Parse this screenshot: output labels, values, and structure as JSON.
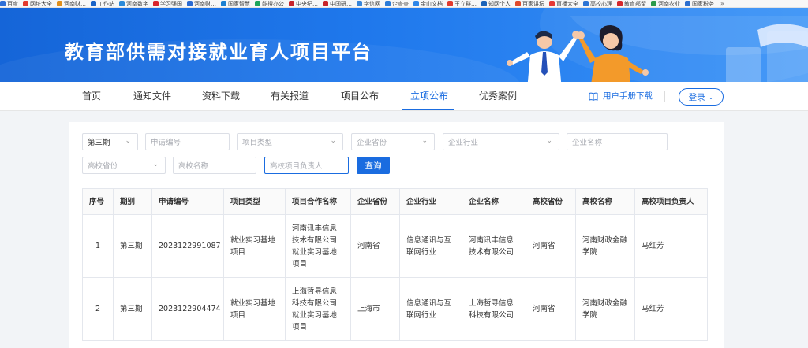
{
  "bookmarks": [
    {
      "label": "百度",
      "color": "#2f6fd6"
    },
    {
      "label": "网址大全",
      "color": "#e13a2f"
    },
    {
      "label": "河南财…",
      "color": "#e08f1c"
    },
    {
      "label": "工作站",
      "color": "#1b64c7"
    },
    {
      "label": "河南数字",
      "color": "#2d8ad8"
    },
    {
      "label": "学习强国",
      "color": "#d9252c"
    },
    {
      "label": "河南财…",
      "color": "#2c6bd2"
    },
    {
      "label": "国家智慧",
      "color": "#1b7fd1"
    },
    {
      "label": "能搜办公",
      "color": "#1ea55c"
    },
    {
      "label": "中央纪…",
      "color": "#c8252b"
    },
    {
      "label": "中国研…",
      "color": "#c8252b"
    },
    {
      "label": "学信网",
      "color": "#3a86d9"
    },
    {
      "label": "企查查",
      "color": "#2b7bd8"
    },
    {
      "label": "金山文档",
      "color": "#2f86e8"
    },
    {
      "label": "王立群…",
      "color": "#e23b2f"
    },
    {
      "label": "知网个人",
      "color": "#1c63b8"
    },
    {
      "label": "百家讲坛",
      "color": "#e04a2a"
    },
    {
      "label": "直播大全",
      "color": "#e53935"
    },
    {
      "label": "高校心理",
      "color": "#2c74d4"
    },
    {
      "label": "教育部留",
      "color": "#d6292d"
    },
    {
      "label": "河南农业",
      "color": "#2c9a4a"
    },
    {
      "label": "国家税务",
      "color": "#2d6fcf"
    }
  ],
  "banner": {
    "title": "教育部供需对接就业育人项目平台"
  },
  "nav": {
    "items": [
      "首页",
      "通知文件",
      "资料下载",
      "有关报道",
      "项目公布",
      "立项公布",
      "优秀案例"
    ],
    "active": "立项公布",
    "manual": "用户手册下载",
    "login": "登录"
  },
  "filters": {
    "period": "第三期",
    "app_no": "申请编号",
    "project_type": "项目类型",
    "ent_province": "企业省份",
    "ent_industry": "企业行业",
    "ent_name": "企业名称",
    "uni_province": "高校省份",
    "uni_name": "高校名称",
    "uni_leader": "高校项目负责人",
    "query": "查询"
  },
  "table": {
    "headers": [
      "序号",
      "期别",
      "申请编号",
      "项目类型",
      "项目合作名称",
      "企业省份",
      "企业行业",
      "企业名称",
      "高校省份",
      "高校名称",
      "高校项目负责人"
    ],
    "rows": [
      [
        "1",
        "第三期",
        "2023122991087",
        "就业实习基地项目",
        "河南讯丰信息技术有限公司就业实习基地项目",
        "河南省",
        "信息通讯与互联网行业",
        "河南讯丰信息技术有限公司",
        "河南省",
        "河南财政金融学院",
        "马红芳"
      ],
      [
        "2",
        "第三期",
        "2023122904474",
        "就业实习基地项目",
        "上海哲寻信息科技有限公司就业实习基地项目",
        "上海市",
        "信息通讯与互联网行业",
        "上海哲寻信息科技有限公司",
        "河南省",
        "河南财政金融学院",
        "马红芳"
      ]
    ]
  }
}
